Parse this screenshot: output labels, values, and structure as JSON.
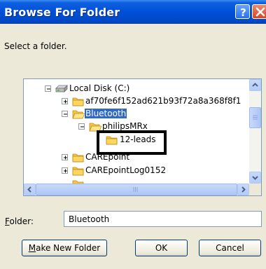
{
  "window": {
    "title": "Browse For Folder",
    "help_button_label": "?",
    "close_button_label": "X"
  },
  "prompt_text": "Select a folder.",
  "tree": {
    "items": [
      {
        "label": "Local Disk (C:)",
        "icon": "hard-drive-icon",
        "expander": "minus"
      },
      {
        "label": "af70fe6f152ad621b93f72a8a368f8f1",
        "icon": "folder-icon",
        "expander": "plus"
      },
      {
        "label": "Bluetooth",
        "icon": "folder-open-icon",
        "expander": "minus",
        "selected": true
      },
      {
        "label": "philipsMRx",
        "icon": "folder-open-icon",
        "expander": "minus"
      },
      {
        "label": "12-leads",
        "icon": "folder-icon",
        "expander": "none"
      },
      {
        "label": "CAREpoint",
        "icon": "folder-icon",
        "expander": "plus"
      },
      {
        "label": "CAREpointLog0152",
        "icon": "folder-icon",
        "expander": "plus"
      }
    ]
  },
  "folder_field": {
    "label_prefix": "F",
    "label_rest": "older:",
    "value": "Bluetooth"
  },
  "buttons": {
    "make_new_folder_accel": "M",
    "make_new_folder_rest": "ake New Folder",
    "ok": "OK",
    "cancel": "Cancel"
  },
  "colors": {
    "titlebar": "#0050d8",
    "selection": "#316ac5",
    "dialog_bg": "#ece9d8",
    "folder": "#f5c542"
  }
}
